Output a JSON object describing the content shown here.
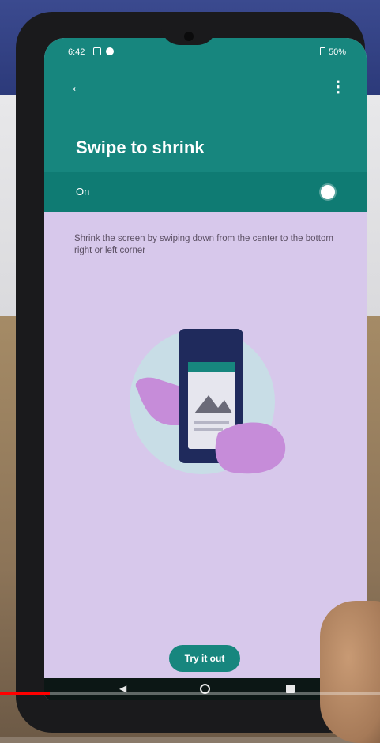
{
  "status_bar": {
    "time": "6:42",
    "battery": "50%"
  },
  "app_bar": {
    "title": "Swipe to shrink",
    "back_icon": "arrow-back-icon",
    "more_icon": "more-vert-icon"
  },
  "setting": {
    "label": "On",
    "enabled": true
  },
  "description": "Shrink the screen by swiping down from the center to the bottom right or left corner",
  "illustration": "hand-holding-phone-illustration",
  "try_button": {
    "label": "Try it out"
  },
  "nav_bar": {
    "icons": [
      "back-triangle-icon",
      "home-circle-icon",
      "recents-square-icon"
    ]
  },
  "video_progress": 0.13,
  "colors": {
    "accent": "#17867e",
    "toggle_row": "#0f7b73",
    "content_bg": "#d7c8eb",
    "progress": "#ff0000"
  }
}
